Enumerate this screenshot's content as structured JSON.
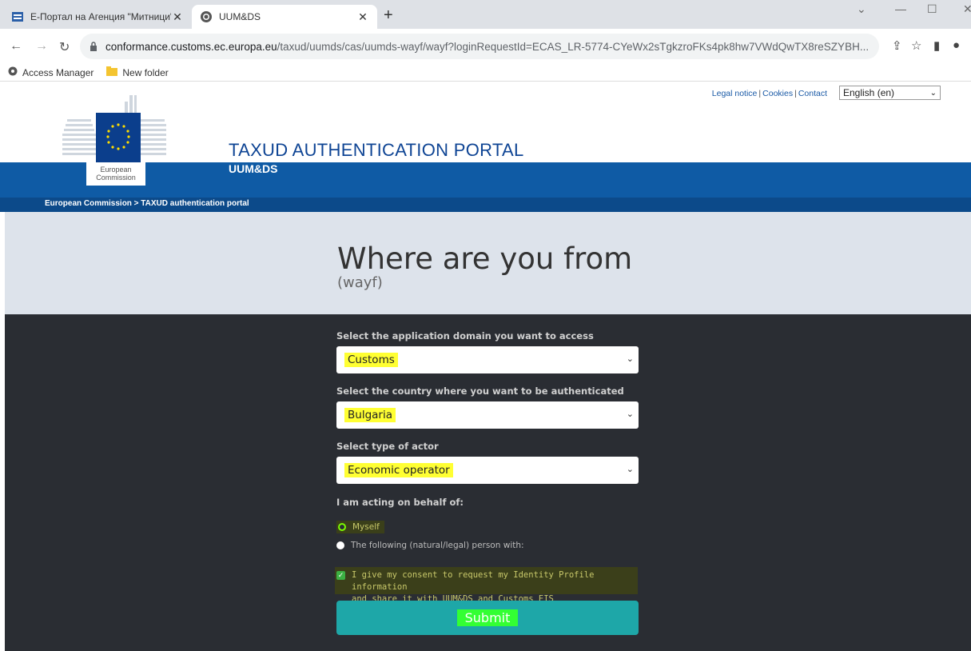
{
  "browser": {
    "tabs": [
      {
        "label": "Е-Портал на Агенция \"Митници\""
      },
      {
        "label": "UUM&DS"
      }
    ],
    "new_tab": "+",
    "url_host": "conformance.customs.ec.europa.eu",
    "url_path": "/taxud/uumds/cas/uumds-wayf/wayf?loginRequestId=ECAS_LR-5774-CYeWx2sTgkzroFKs4pk8hw7VWdQwTX8reSZYBH...",
    "bookmarks": [
      {
        "label": "Access Manager"
      },
      {
        "label": "New folder"
      }
    ]
  },
  "header": {
    "logo_text_line1": "European",
    "logo_text_line2": "Commission",
    "top_links": [
      "Legal notice",
      "Cookies",
      "Contact"
    ],
    "language": "English (en)",
    "portal_title": "TAXUD AUTHENTICATION PORTAL",
    "portal_subtitle": "UUM&DS",
    "breadcrumb": "European Commission > TAXUD authentication portal"
  },
  "main": {
    "title": "Where are you from",
    "subtitle": "(wayf)",
    "domain_label": "Select the application domain you want to access",
    "domain_value": "Customs",
    "country_label": "Select the country where you want to be authenticated",
    "country_value": "Bulgaria",
    "actor_label": "Select type of actor",
    "actor_value": "Economic operator",
    "behalf_label": "I am acting on behalf of:",
    "option_myself": "Myself",
    "option_other": "The following (natural/legal) person with:",
    "consent_line1": "I give my consent to request my Identity Profile information",
    "consent_line2": "and share it with UUM&DS and Customs EIS",
    "submit_label": "Submit"
  },
  "colors": {
    "brand_blue": "#0f5ba5",
    "highlight_yellow": "#ffff33",
    "highlight_green": "#33ff33",
    "submit_teal": "#1ea7a8"
  }
}
